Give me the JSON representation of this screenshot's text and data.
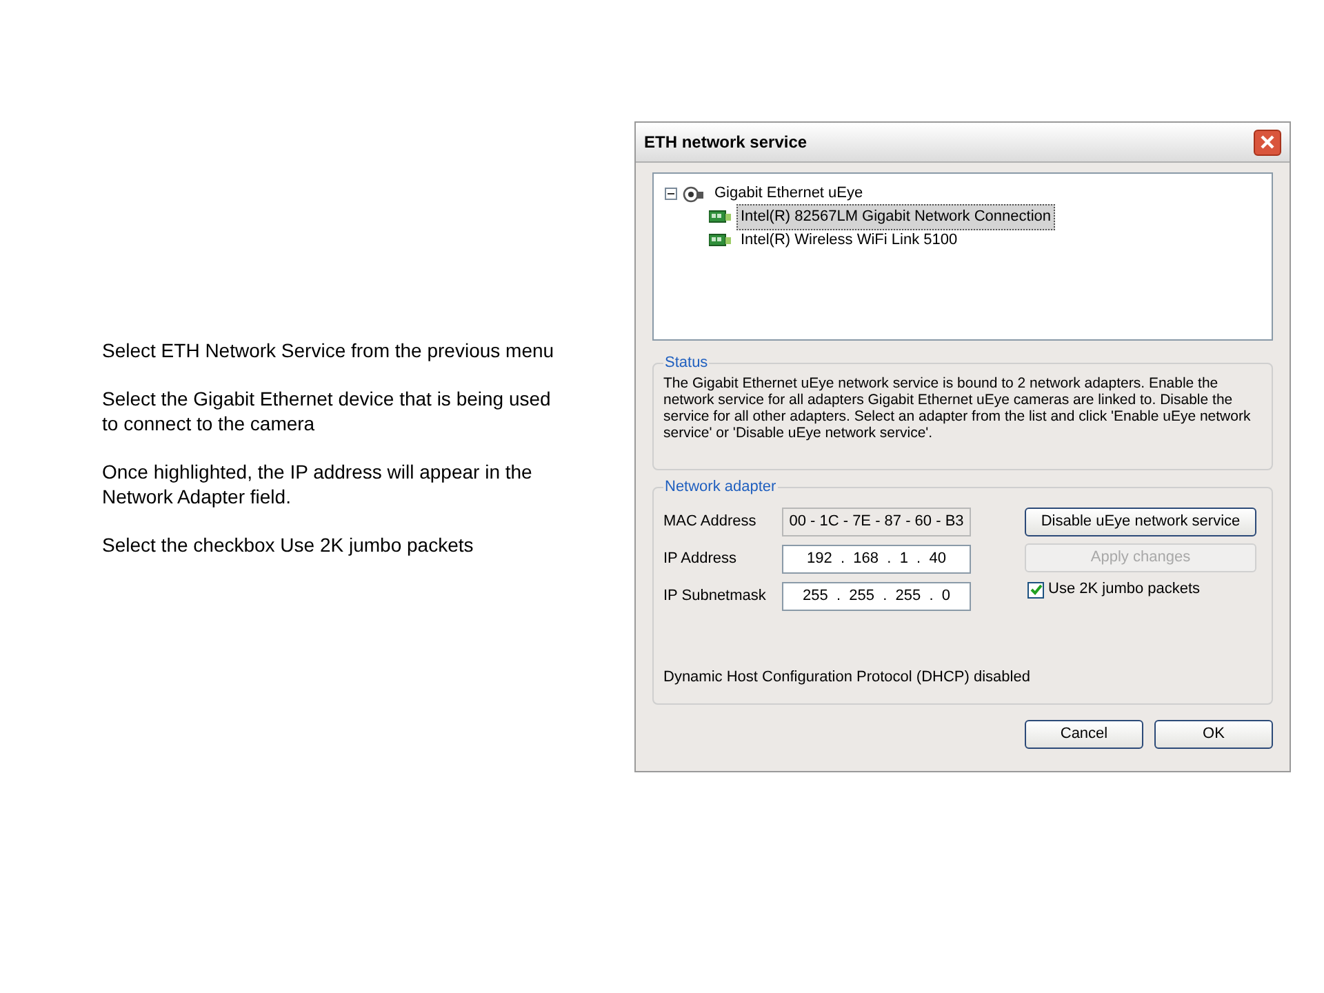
{
  "slide_text": [
    "Select ETH Network Service from the previous menu",
    "Select the Gigabit Ethernet device that is being used to connect to the camera",
    "Once highlighted, the IP address will appear in the Network Adapter field.",
    "Select the checkbox Use 2K jumbo packets"
  ],
  "window": {
    "title": "ETH network service"
  },
  "tree": [
    {
      "label": "Gigabit Ethernet uEye",
      "expanded": true,
      "selected": false,
      "children": [
        {
          "label": "Intel(R) 82567LM Gigabit Network Connection",
          "selected": true
        },
        {
          "label": "Intel(R) Wireless WiFi Link 5100",
          "selected": false
        }
      ]
    }
  ],
  "status": {
    "title": "Status",
    "text": "The Gigabit Ethernet uEye network service is bound to 2 network adapters. Enable the network service for all adapters Gigabit Ethernet uEye cameras are linked to. Disable the service for all other adapters. Select an adapter from the list and click 'Enable uEye network service' or 'Disable uEye network service'."
  },
  "network_adapter": {
    "title": "Network adapter",
    "fields": [
      {
        "label": "MAC Address",
        "kind": "readonly",
        "parts": [
          "00",
          "1C",
          "7E",
          "87",
          "60",
          "B3"
        ],
        "separator": "-"
      },
      {
        "label": "IP Address",
        "kind": "ip",
        "parts": [
          "192",
          "168",
          "1",
          "40"
        ],
        "separator": "."
      },
      {
        "label": "IP Subnetmask",
        "kind": "ip",
        "parts": [
          "255",
          "255",
          "255",
          "0"
        ],
        "separator": "."
      }
    ],
    "buttons": [
      {
        "label": "Disable uEye network service",
        "disabled": false
      },
      {
        "label": "Apply changes",
        "disabled": true
      }
    ],
    "checkbox": {
      "label": "Use 2K jumbo packets",
      "checked": true
    },
    "dhcp_text": "Dynamic Host Configuration Protocol (DHCP) disabled"
  },
  "buttons": [
    {
      "label": "Cancel"
    },
    {
      "label": "OK"
    }
  ]
}
